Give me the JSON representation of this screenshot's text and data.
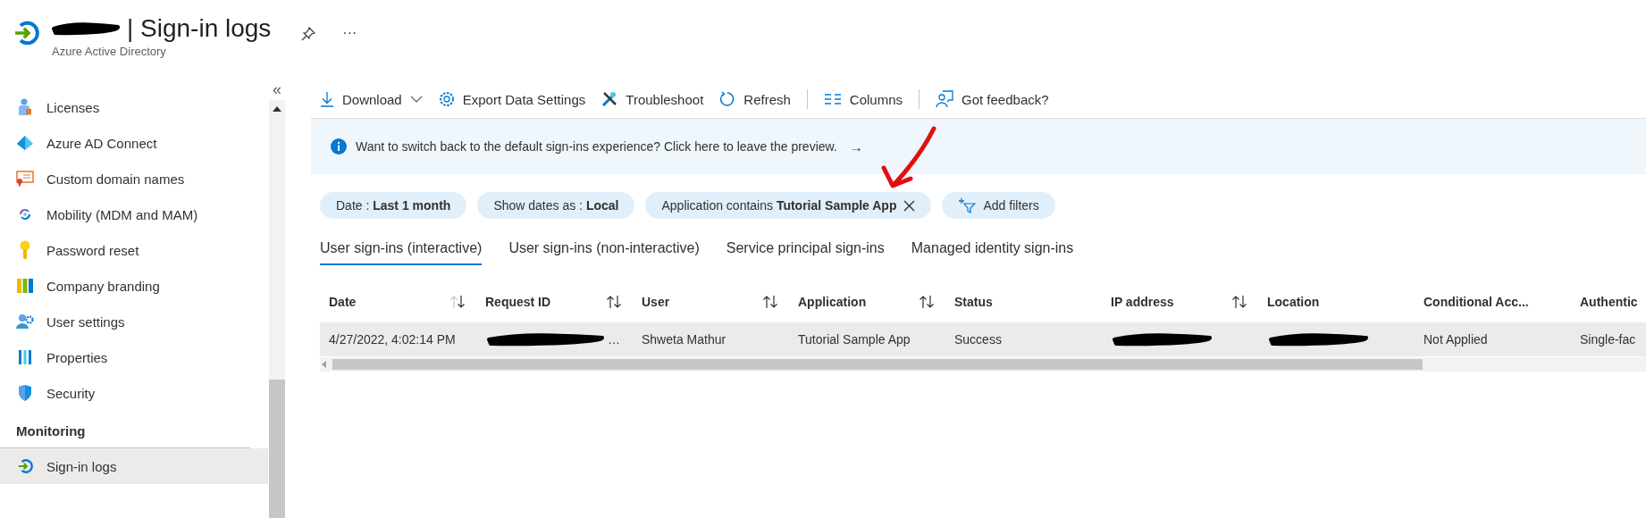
{
  "header": {
    "title": "| Sign-in logs",
    "more": "···",
    "subtitle": "Azure Active Directory",
    "redacted": true
  },
  "sidebar": {
    "collapse": "«",
    "items": [
      {
        "label": "Licenses",
        "selected": false
      },
      {
        "label": "Azure AD Connect",
        "selected": false
      },
      {
        "label": "Custom domain names",
        "selected": false
      },
      {
        "label": "Mobility (MDM and MAM)",
        "selected": false
      },
      {
        "label": "Password reset",
        "selected": false
      },
      {
        "label": "Company branding",
        "selected": false
      },
      {
        "label": "User settings",
        "selected": false
      },
      {
        "label": "Properties",
        "selected": false
      },
      {
        "label": "Security",
        "selected": false
      }
    ],
    "section": "Monitoring",
    "section_items": [
      {
        "label": "Sign-in logs",
        "selected": true
      }
    ]
  },
  "toolbar": [
    {
      "label": "Download",
      "dropdown": true
    },
    {
      "label": "Export Data Settings",
      "dropdown": false
    },
    {
      "label": "Troubleshoot",
      "dropdown": false
    },
    {
      "label": "Refresh",
      "dropdown": false
    },
    {
      "label": "Columns",
      "dropdown": false
    },
    {
      "label": "Got feedback?",
      "dropdown": false
    }
  ],
  "banner": {
    "text": "Want to switch back to the default sign-ins experience? Click here to leave the preview.",
    "arrow": "→"
  },
  "filters": [
    {
      "kind": "filter",
      "text": "Date : **Last 1 month**",
      "removable": false
    },
    {
      "kind": "filter",
      "text": "Show dates as : **Local**",
      "removable": false
    },
    {
      "kind": "filter",
      "text": "Application contains **Tutorial Sample App**",
      "removable": true
    },
    {
      "kind": "add",
      "text": "Add filters",
      "removable": false
    }
  ],
  "tabs": [
    {
      "label": "User sign-ins (interactive)",
      "selected": true
    },
    {
      "label": "User sign-ins (non-interactive)",
      "selected": false
    },
    {
      "label": "Service principal sign-ins",
      "selected": false
    },
    {
      "label": "Managed identity sign-ins",
      "selected": false
    }
  ],
  "table": {
    "columns": [
      {
        "label": "Date",
        "sortable": true,
        "sorted": true
      },
      {
        "label": "Request ID",
        "sortable": true,
        "sorted": false
      },
      {
        "label": "User",
        "sortable": true,
        "sorted": false
      },
      {
        "label": "Application",
        "sortable": true,
        "sorted": false
      },
      {
        "label": "Status",
        "sortable": false
      },
      {
        "label": "IP address",
        "sortable": true,
        "sorted": false
      },
      {
        "label": "Location",
        "sortable": false
      },
      {
        "label": "Conditional Acc...",
        "sortable": false
      },
      {
        "label": "Authentic",
        "sortable": false
      }
    ],
    "rows": [
      {
        "selected": true,
        "cells": [
          {
            "text": "4/27/2022, 4:02:14 PM",
            "redacted": false
          },
          {
            "text": "…",
            "redacted": true
          },
          {
            "text": "Shweta Mathur",
            "redacted": false
          },
          {
            "text": "Tutorial Sample App",
            "redacted": false
          },
          {
            "text": "Success",
            "redacted": false
          },
          {
            "redacted": true
          },
          {
            "redacted": true
          },
          {
            "text": "Not Applied",
            "redacted": false
          },
          {
            "text": "Single-fac",
            "redacted": false
          }
        ]
      }
    ]
  },
  "annotation": {
    "kind": "arrow",
    "color": "#e01010"
  }
}
